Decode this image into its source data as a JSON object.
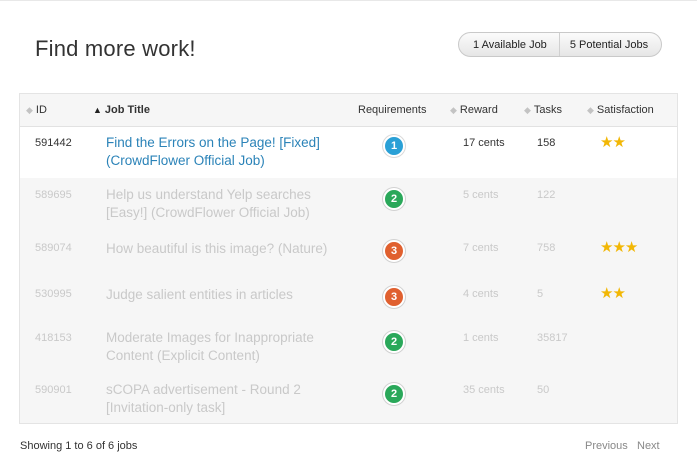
{
  "header": {
    "title": "Find more work!",
    "toggle": {
      "available": "1 Available Job",
      "potential": "5 Potential Jobs"
    }
  },
  "table": {
    "columns": {
      "id": "ID",
      "title": "Job Title",
      "requirements": "Requirements",
      "reward": "Reward",
      "tasks": "Tasks",
      "satisfaction": "Satisfaction"
    },
    "rows": [
      {
        "id": "591442",
        "title": "Find the Errors on the Page! [Fixed] (CrowdFlower Official Job)",
        "level": "1",
        "reward": "17 cents",
        "tasks": "158",
        "stars": "★★",
        "active": true
      },
      {
        "id": "589695",
        "title": "Help us understand Yelp searches [Easy!] (CrowdFlower Official Job)",
        "level": "2",
        "reward": "5 cents",
        "tasks": "122",
        "stars": "",
        "active": false
      },
      {
        "id": "589074",
        "title": "How beautiful is this image? (Nature)",
        "level": "3",
        "reward": "7 cents",
        "tasks": "758",
        "stars": "★★★",
        "active": false
      },
      {
        "id": "530995",
        "title": "Judge salient entities in articles",
        "level": "3",
        "reward": "4 cents",
        "tasks": "5",
        "stars": "★★",
        "active": false
      },
      {
        "id": "418153",
        "title": "Moderate Images for Inappropriate Content (Explicit Content)",
        "level": "2",
        "reward": "1 cents",
        "tasks": "35817",
        "stars": "",
        "active": false
      },
      {
        "id": "590901",
        "title": "sCOPA advertisement - Round 2 [Invitation-only task]",
        "level": "2",
        "reward": "35 cents",
        "tasks": "50",
        "stars": "",
        "active": false
      }
    ]
  },
  "footer": {
    "summary": "Showing 1 to 6 of 6 jobs",
    "previous": "Previous",
    "next": "Next"
  },
  "colors": {
    "link": "#2b83b8",
    "star": "#f2b705",
    "level1": "#2aa0d6",
    "level2": "#2aa85a",
    "level3": "#e0602f"
  }
}
